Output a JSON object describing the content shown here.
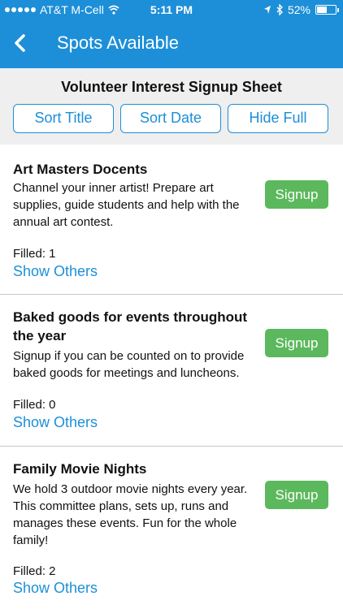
{
  "status_bar": {
    "carrier": "AT&T M-Cell",
    "time": "5:11 PM",
    "battery": "52%",
    "battery_level": 0.52,
    "icons": [
      "signal-dots-icon",
      "wifi-icon",
      "location-arrow-icon",
      "bluetooth-icon",
      "battery-icon"
    ]
  },
  "nav": {
    "title": "Spots Available",
    "back_icon": "chevron-left-icon"
  },
  "sheet": {
    "title": "Volunteer Interest Signup Sheet",
    "buttons": [
      "Sort Title",
      "Sort Date",
      "Hide Full"
    ]
  },
  "slots": [
    {
      "title": "Art Masters Docents",
      "description": "Channel your inner artist! Prepare art supplies, guide students and help with the annual art contest.",
      "filled": "Filled: 1",
      "show_others": "Show Others",
      "signup": "Signup"
    },
    {
      "title": "Baked goods for events throughout the year",
      "description": "Signup if you can be counted on to provide baked goods for meetings and luncheons.",
      "filled": "Filled: 0",
      "show_others": "Show Others",
      "signup": "Signup"
    },
    {
      "title": "Family Movie Nights",
      "description": "We hold 3 outdoor movie nights every year. This committee plans, sets up, runs and manages these events. Fun for the whole family!",
      "filled": "Filled: 2",
      "show_others": "Show Others",
      "signup": "Signup"
    }
  ],
  "colors": {
    "accent": "#1d8fd8",
    "signup": "#5cb85c",
    "header_bg": "#efefef"
  }
}
